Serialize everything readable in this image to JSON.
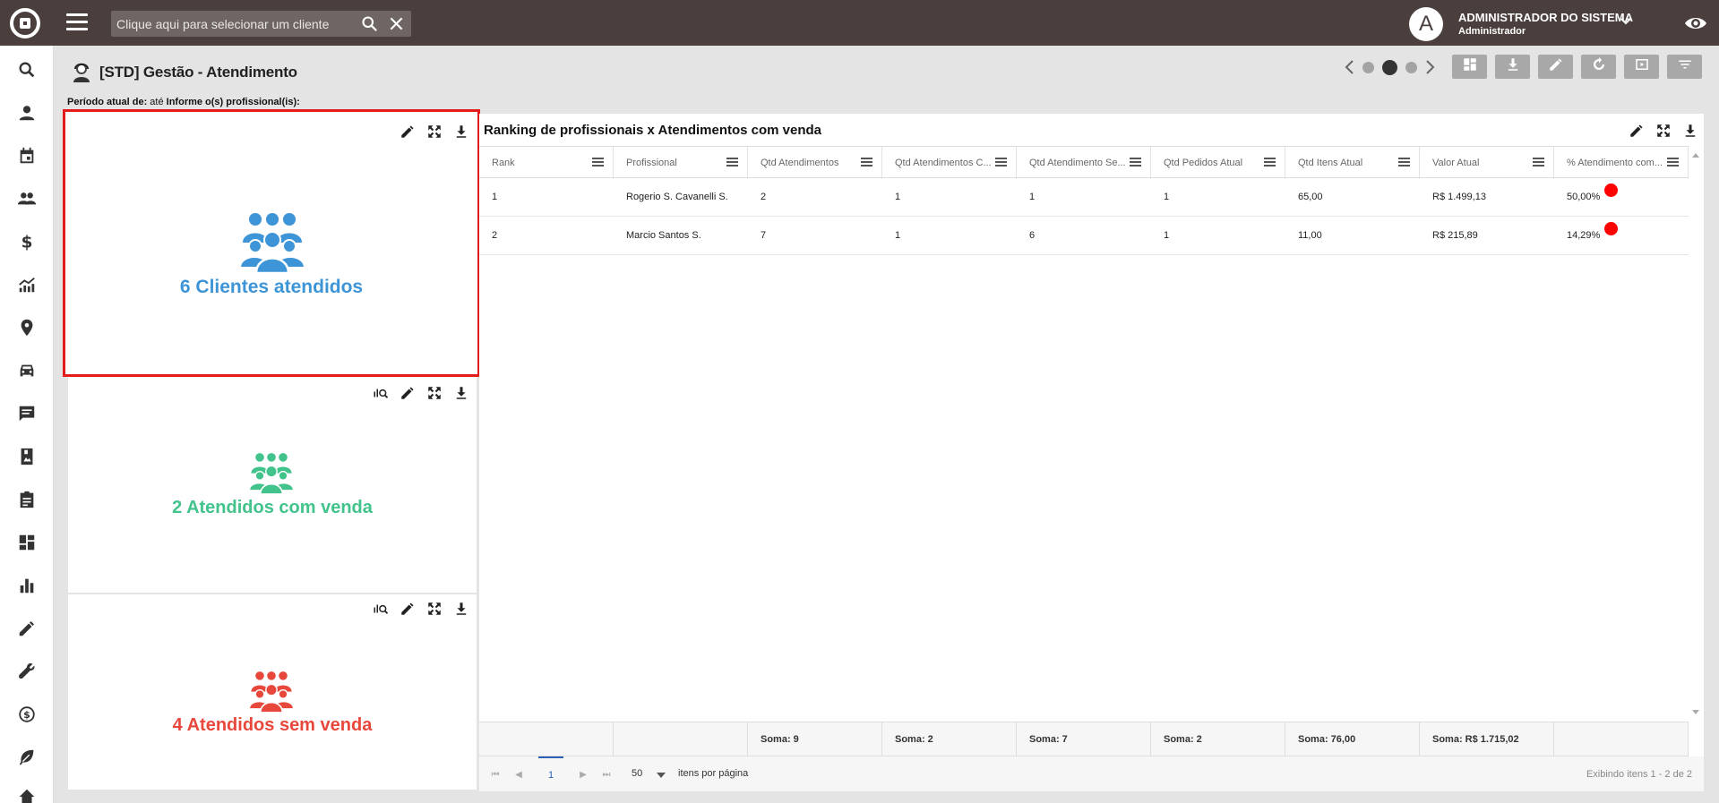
{
  "topbar": {
    "search_placeholder": "Clique aqui para selecionar um cliente",
    "user_initial": "A",
    "user_name": "ADMINISTRADOR DO SISTEMA",
    "user_role": "Administrador"
  },
  "page": {
    "title": "[STD] Gestão - Atendimento",
    "filter_label_period": "Período atual de:",
    "filter_value_period": " até ",
    "filter_label_prof": "Informe o(s) profissional(is):"
  },
  "kpis": [
    {
      "text": "6 Clientes atendidos",
      "color": "#3d95d7"
    },
    {
      "text": "2 Atendidos com venda",
      "color": "#42c38b"
    },
    {
      "text": "4 Atendidos sem venda",
      "color": "#e8483c"
    }
  ],
  "grid": {
    "title": "Ranking de profissionais x Atendimentos com venda",
    "columns": [
      "Rank",
      "Profissional",
      "Qtd Atendimentos",
      "Qtd Atendimentos C...",
      "Qtd Atendimento Se...",
      "Qtd Pedidos Atual",
      "Qtd Itens Atual",
      "Valor Atual",
      "% Atendimento com..."
    ],
    "rows": [
      [
        "1",
        "Rogerio S. Cavanelli S.",
        "2",
        "1",
        "1",
        "1",
        "65,00",
        "R$ 1.499,13",
        "50,00%"
      ],
      [
        "2",
        "Marcio Santos S.",
        "7",
        "1",
        "6",
        "1",
        "11,00",
        "R$ 215,89",
        "14,29%"
      ]
    ],
    "footer": [
      "",
      "",
      "Soma: 9",
      "Soma: 2",
      "Soma: 7",
      "Soma: 2",
      "Soma: 76,00",
      "Soma: R$ 1.715,02",
      ""
    ],
    "pager": {
      "current_page": "1",
      "page_size": "50",
      "per_page_label": "itens por página",
      "info": "Exibindo itens 1 - 2 de 2"
    }
  }
}
